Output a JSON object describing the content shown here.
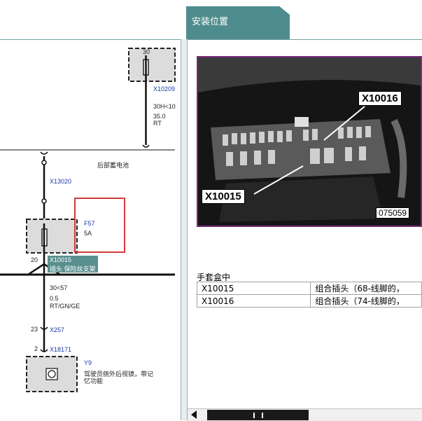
{
  "header": {
    "tab_title": "安装位置"
  },
  "diagram": {
    "pin_top": "30",
    "conn_top": "X10209",
    "top_signal": "30H<10",
    "top_size": "35.0",
    "top_color": "RT",
    "rear_battery_label": "后部蓄电池",
    "conn_mid": "X13020",
    "fuse_id": "F57",
    "fuse_rating": "5A",
    "pin_20": "20",
    "conn_x10015": "X10015",
    "conn_x10015_desc": "插头 保险丝支架",
    "wire_signal": "30<57",
    "wire_size": "0.5",
    "wire_color": "RT/GN/GE",
    "pin_23": "23",
    "conn_x257": "X257",
    "pin_2": "2",
    "conn_x18171": "X18171",
    "comp_id": "Y9",
    "comp_desc_line1": "驾驶员侧外后视镜，带记",
    "comp_desc_line2": "忆功能"
  },
  "photo": {
    "callout_1": "X10016",
    "callout_2": "X10015",
    "image_id": "075059"
  },
  "location": {
    "title": "手套盒中",
    "rows": [
      {
        "connector": "X10015",
        "desc": "组合插头（68-线脚的，"
      },
      {
        "connector": "X10016",
        "desc": "组合插头（74-线脚的，"
      }
    ]
  },
  "colors": {
    "tab_bg": "#4f8c8d",
    "photo_border": "#7a2a7a",
    "highlight_box": "#d43a3a",
    "connector_label_bg": "#5a8f8f"
  }
}
